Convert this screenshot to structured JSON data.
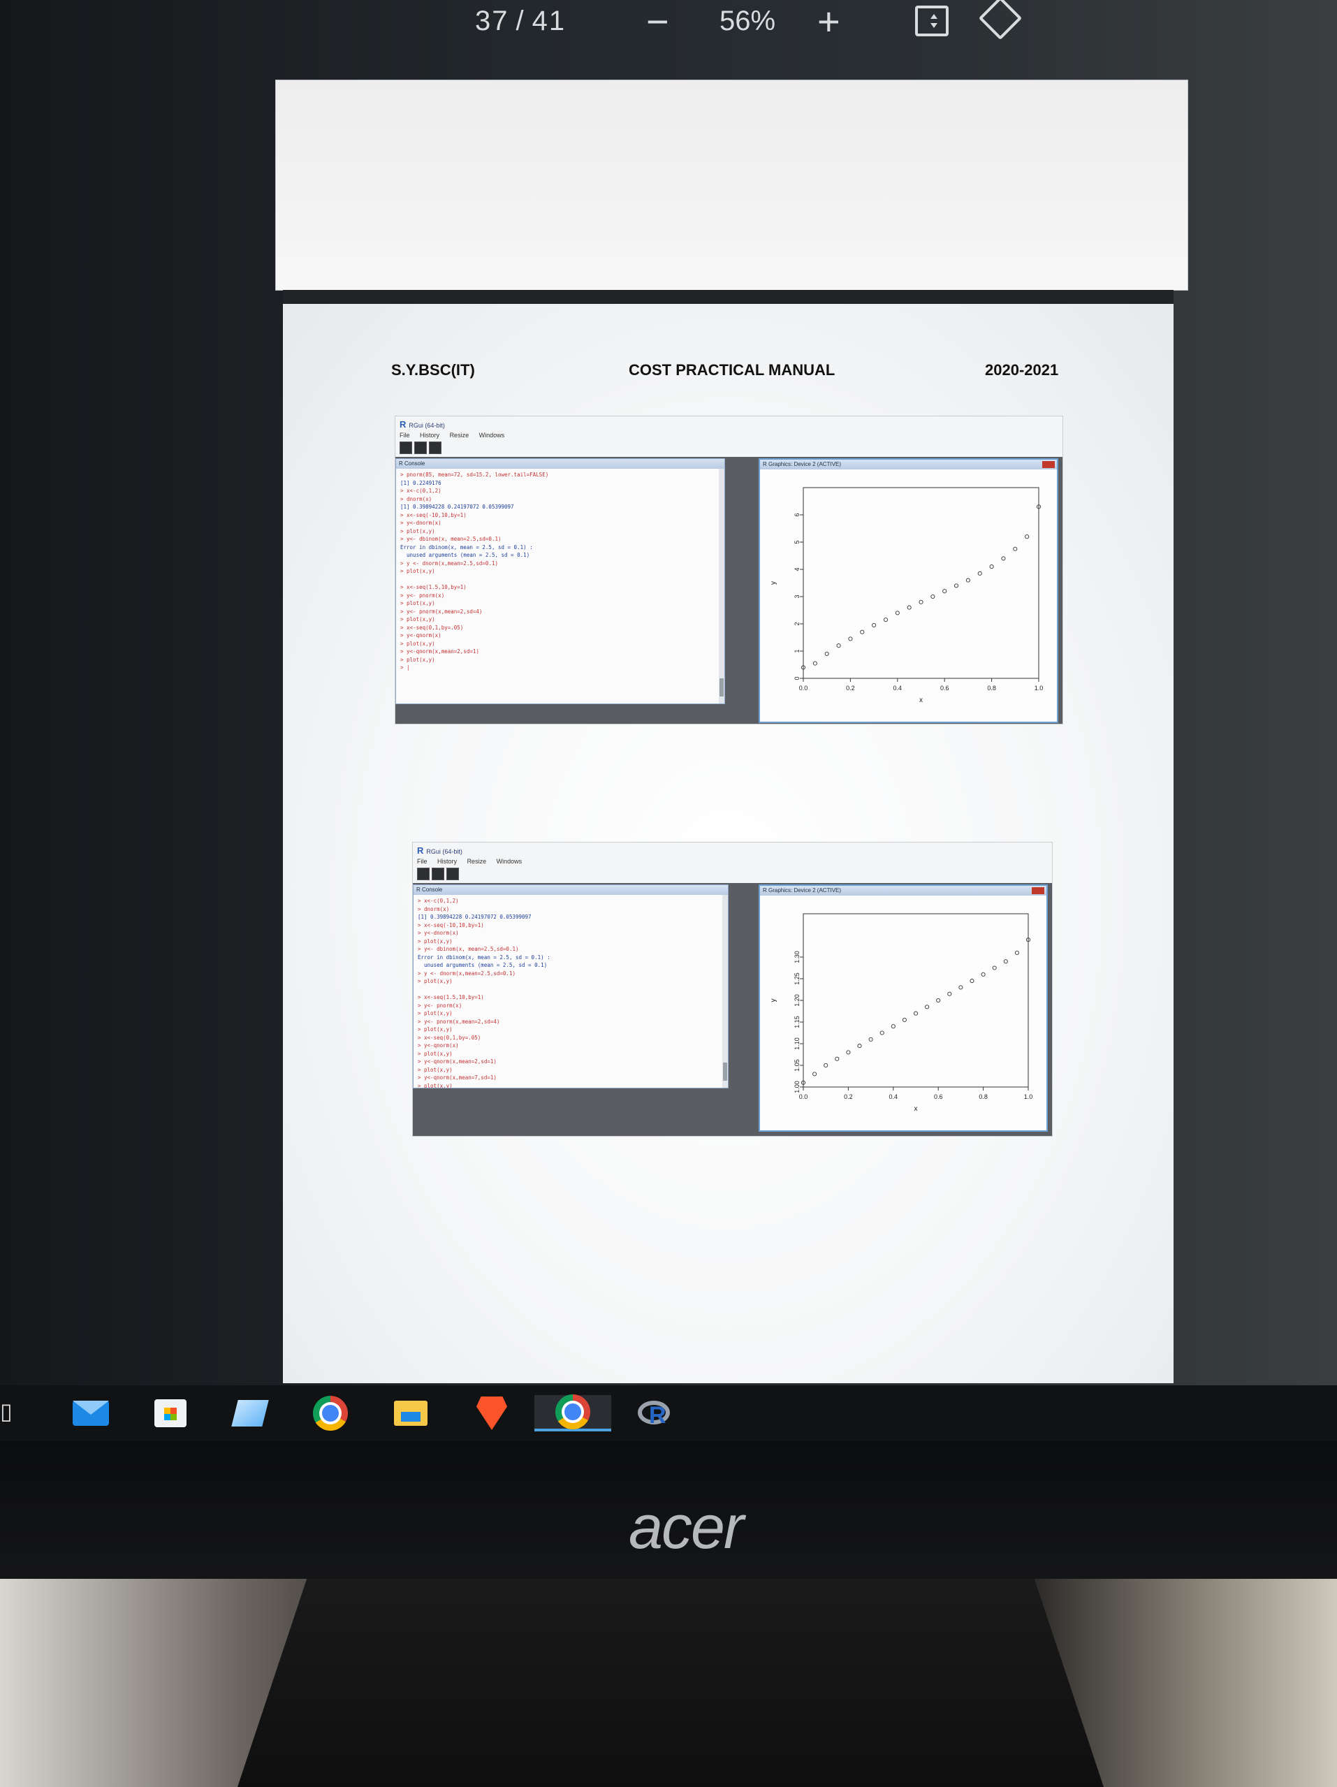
{
  "viewer": {
    "page_current": "37",
    "page_sep": "/",
    "page_total": "41",
    "zoom_minus": "−",
    "zoom": "56%",
    "zoom_plus": "+"
  },
  "page": {
    "header_left": "S.Y.BSC(IT)",
    "header_center": "COST PRACTICAL MANUAL",
    "header_right": "2020-2021"
  },
  "rgui": {
    "title": "RGui (64-bit)",
    "logo": "R",
    "menu": [
      "File",
      "History",
      "Resize",
      "Windows"
    ],
    "console_title": "R Console",
    "graphics_title": "R Graphics: Device 2 (ACTIVE)"
  },
  "console1_lines": [
    "> pnorm(85, mean=72, sd=15.2, lower.tail=FALSE)",
    "[1] 0.2249176",
    "> x<-c(0,1,2)",
    "> dnorm(x)",
    "[1] 0.39894228 0.24197072 0.05399097",
    "> x<-seq(-10,10,by=1)",
    "> y<-dnorm(x)",
    "> plot(x,y)",
    "> y<- dbinom(x, mean=2.5,sd=0.1)",
    "Error in dbinom(x, mean = 2.5, sd = 0.1) :",
    "  unused arguments (mean = 2.5, sd = 0.1)",
    "> y <- dnorm(x,mean=2.5,sd=0.1)",
    "> plot(x,y)",
    "",
    "> x<-seq(1.5,10,by=1)",
    "> y<- pnorm(x)",
    "> plot(x,y)",
    "> y<- pnorm(x,mean=2,sd=4)",
    "> plot(x,y)",
    "> x<-seq(0,1,by=.05)",
    "> y<-qnorm(x)",
    "> plot(x,y)",
    "> y<-qnorm(x,mean=2,sd=1)",
    "> plot(x,y)",
    "> |"
  ],
  "console2_lines": [
    "> x<-c(0,1,2)",
    "> dnorm(x)",
    "[1] 0.39894228 0.24197072 0.05399097",
    "> x<-seq(-10,10,by=1)",
    "> y<-dnorm(x)",
    "> plot(x,y)",
    "> y<- dbinom(x, mean=2.5,sd=0.1)",
    "Error in dbinom(x, mean = 2.5, sd = 0.1) :",
    "  unused arguments (mean = 2.5, sd = 0.1)",
    "> y <- dnorm(x,mean=2.5,sd=0.1)",
    "> plot(x,y)",
    "",
    "> x<-seq(1.5,10,by=1)",
    "> y<- pnorm(x)",
    "> plot(x,y)",
    "> y<- pnorm(x,mean=2,sd=4)",
    "> plot(x,y)",
    "> x<-seq(0,1,by=.05)",
    "> y<-qnorm(x)",
    "> plot(x,y)",
    "> y<-qnorm(x,mean=2,sd=1)",
    "> plot(x,y)",
    "> y<-qnorm(x,mean=7,sd=1)",
    "> plot(x,y)",
    "> |"
  ],
  "chart_data": [
    {
      "type": "scatter",
      "title": "",
      "xlabel": "x",
      "ylabel": "y",
      "xlim": [
        0,
        1
      ],
      "ylim": [
        0,
        7
      ],
      "xticks": [
        "0.0",
        "0.2",
        "0.4",
        "0.6",
        "0.8",
        "1.0"
      ],
      "yticks": [
        "0",
        "1",
        "2",
        "3",
        "4",
        "5",
        "6"
      ],
      "x": [
        0.0,
        0.05,
        0.1,
        0.15,
        0.2,
        0.25,
        0.3,
        0.35,
        0.4,
        0.45,
        0.5,
        0.55,
        0.6,
        0.65,
        0.7,
        0.75,
        0.8,
        0.85,
        0.9,
        0.95,
        1.0
      ],
      "y": [
        0.4,
        0.55,
        0.9,
        1.2,
        1.45,
        1.7,
        1.95,
        2.15,
        2.4,
        2.6,
        2.8,
        3.0,
        3.2,
        3.4,
        3.6,
        3.85,
        4.1,
        4.4,
        4.75,
        5.2,
        6.3
      ]
    },
    {
      "type": "scatter",
      "title": "",
      "xlabel": "x",
      "ylabel": "y",
      "xlim": [
        0,
        1
      ],
      "ylim": [
        1.0,
        1.4
      ],
      "xticks": [
        "0.0",
        "0.2",
        "0.4",
        "0.6",
        "0.8",
        "1.0"
      ],
      "yticks": [
        "1.00",
        "1.05",
        "1.10",
        "1.15",
        "1.20",
        "1.25",
        "1.30"
      ],
      "x": [
        0.0,
        0.05,
        0.1,
        0.15,
        0.2,
        0.25,
        0.3,
        0.35,
        0.4,
        0.45,
        0.5,
        0.55,
        0.6,
        0.65,
        0.7,
        0.75,
        0.8,
        0.85,
        0.9,
        0.95,
        1.0
      ],
      "y": [
        1.01,
        1.03,
        1.05,
        1.065,
        1.08,
        1.095,
        1.11,
        1.125,
        1.14,
        1.155,
        1.17,
        1.185,
        1.2,
        1.215,
        1.23,
        1.245,
        1.26,
        1.275,
        1.29,
        1.31,
        1.34
      ]
    }
  ],
  "taskbar": {
    "icons": [
      "task-view-icon",
      "mail-icon",
      "store-icon",
      "sticky-notes-icon",
      "chrome-icon",
      "file-explorer-icon",
      "brave-icon",
      "chrome-icon",
      "r-app-icon"
    ]
  },
  "monitor": {
    "brand": "acer"
  }
}
